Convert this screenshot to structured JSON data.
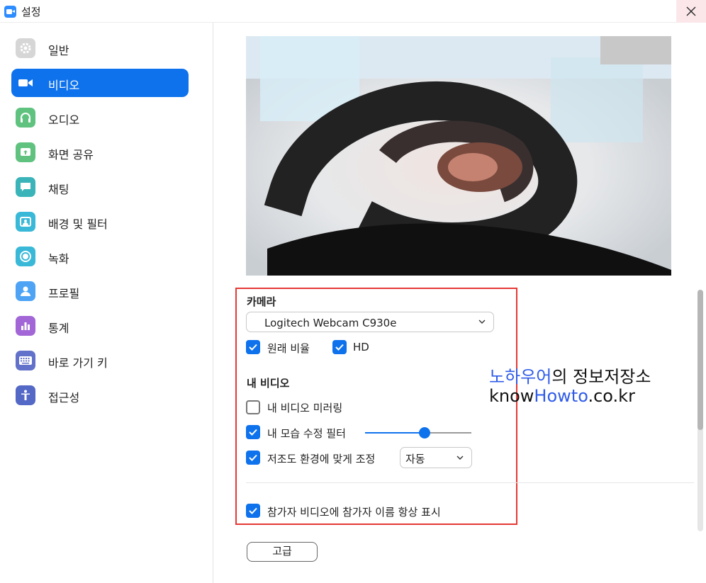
{
  "window": {
    "title": "설정"
  },
  "colors": {
    "accent": "#0e72ed",
    "highlight_box": "#e53935",
    "watermark_blue": "#2f5be8"
  },
  "sidebar": {
    "items": [
      {
        "label": "일반",
        "icon": "gear-icon",
        "color": "#d6d6d6",
        "active": false
      },
      {
        "label": "비디오",
        "icon": "video-camera-icon",
        "color": "#0e72ed",
        "active": true
      },
      {
        "label": "오디오",
        "icon": "headphones-icon",
        "color": "#60c27f",
        "active": false
      },
      {
        "label": "화면 공유",
        "icon": "share-screen-icon",
        "color": "#60c27f",
        "active": false
      },
      {
        "label": "채팅",
        "icon": "chat-bubble-icon",
        "color": "#3ab4b8",
        "active": false
      },
      {
        "label": "배경 및 필터",
        "icon": "background-icon",
        "color": "#39b8d8",
        "active": false
      },
      {
        "label": "녹화",
        "icon": "record-icon",
        "color": "#39b8d8",
        "active": false
      },
      {
        "label": "프로필",
        "icon": "profile-icon",
        "color": "#4ea3f5",
        "active": false
      },
      {
        "label": "통계",
        "icon": "statistics-icon",
        "color": "#a266d6",
        "active": false
      },
      {
        "label": "바로 가기 키",
        "icon": "keyboard-icon",
        "color": "#6271c9",
        "active": false
      },
      {
        "label": "접근성",
        "icon": "accessibility-icon",
        "color": "#5468c6",
        "active": false
      }
    ]
  },
  "video": {
    "camera_title": "카메라",
    "camera_select": "Logitech Webcam C930e",
    "original_ratio": {
      "label": "원래 비율",
      "checked": true
    },
    "hd": {
      "label": "HD",
      "checked": true
    },
    "my_video_title": "내 비디오",
    "mirror": {
      "label": "내 비디오 미러링",
      "checked": false
    },
    "touch_up": {
      "label": "내 모습 수정 필터",
      "checked": true,
      "level": 0.56
    },
    "low_light": {
      "label": "저조도 환경에 맞게 조정",
      "checked": true,
      "mode": "자동"
    },
    "show_names": {
      "label": "참가자 비디오에 참가자 이름 항상 표시",
      "checked": true
    },
    "advanced_button": "고급"
  },
  "watermark": {
    "line1_blue": "노하우어",
    "line1_rest": "의 정보저장소",
    "line2_a": "know",
    "line2_blue": "Howto",
    "line2_c": ".co.kr"
  }
}
